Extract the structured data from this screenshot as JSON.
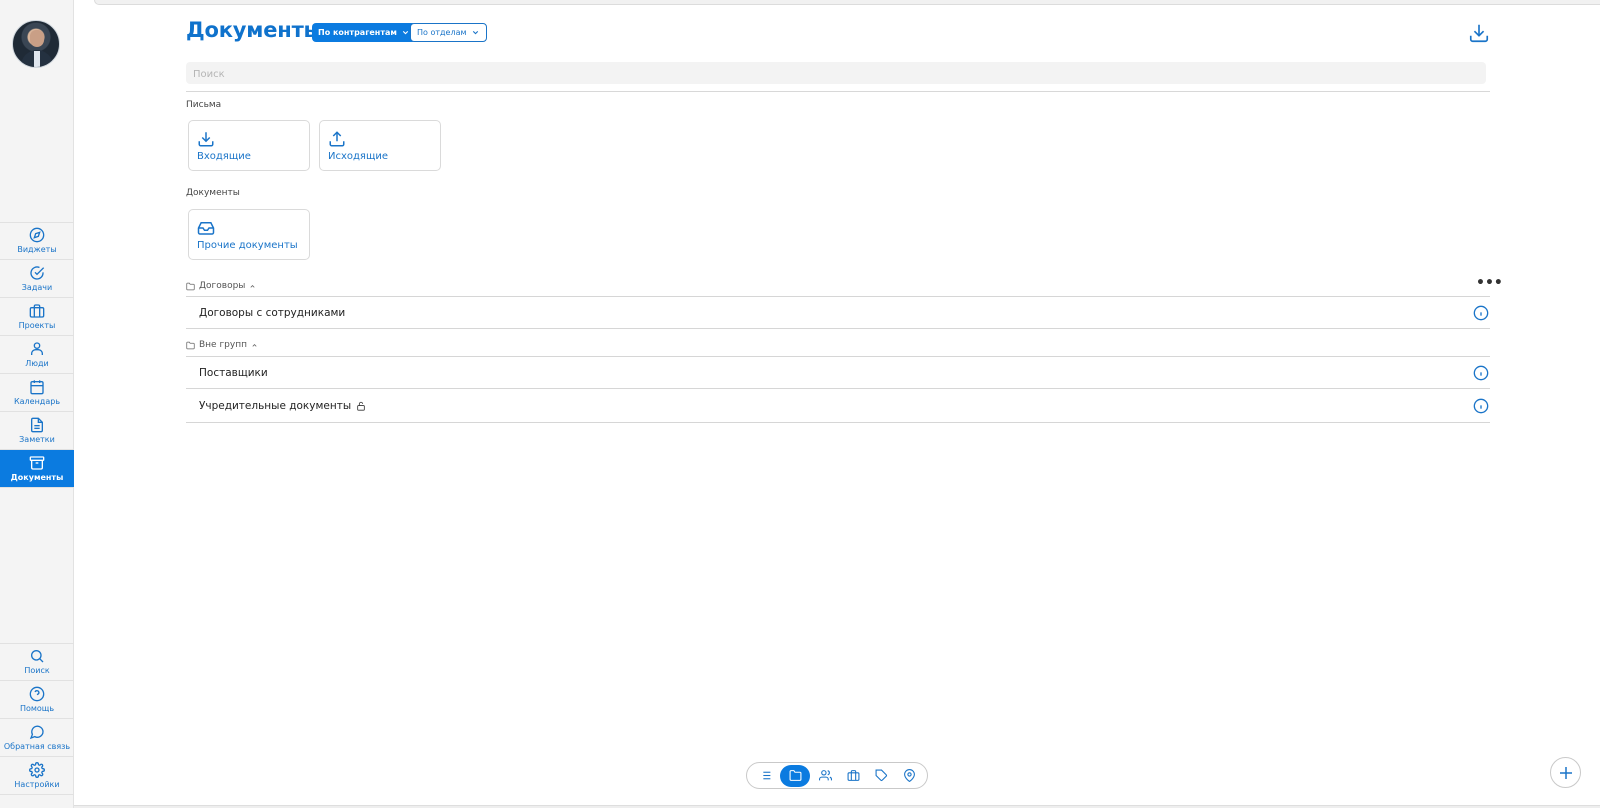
{
  "colors": {
    "accent": "#0b7be0",
    "link": "#1a74c8",
    "sidebar_bg": "#f4f4f4"
  },
  "sidebar": {
    "avatar": "avatar-photo",
    "items": [
      {
        "label": "Виджеты",
        "icon": "compass-icon",
        "active": false
      },
      {
        "label": "Задачи",
        "icon": "check-circle-icon",
        "active": false
      },
      {
        "label": "Проекты",
        "icon": "briefcase-icon",
        "active": false
      },
      {
        "label": "Люди",
        "icon": "user-icon",
        "active": false
      },
      {
        "label": "Календарь",
        "icon": "calendar-icon",
        "active": false
      },
      {
        "label": "Заметки",
        "icon": "note-icon",
        "active": false
      },
      {
        "label": "Документы",
        "icon": "archive-icon",
        "active": true
      }
    ],
    "bottom_items": [
      {
        "label": "Поиск",
        "icon": "search-icon"
      },
      {
        "label": "Помощь",
        "icon": "help-icon"
      },
      {
        "label": "Обратная связь",
        "icon": "chat-icon"
      },
      {
        "label": "Настройки",
        "icon": "gear-icon"
      }
    ]
  },
  "header": {
    "title": "Документы",
    "filter_primary": "По контрагентам",
    "filter_secondary": "По отделам",
    "download_icon": "download-icon"
  },
  "search": {
    "placeholder": "Поиск",
    "value": ""
  },
  "letters": {
    "section_label": "Письма",
    "cards": [
      {
        "label": "Входящие",
        "icon": "download-icon"
      },
      {
        "label": "Исходящие",
        "icon": "upload-icon"
      }
    ]
  },
  "documents": {
    "section_label": "Документы",
    "cards": [
      {
        "label": "Прочие документы",
        "icon": "inbox-icon"
      }
    ]
  },
  "groups": [
    {
      "name": "Договоры",
      "rows": [
        {
          "label": "Договоры с сотрудниками",
          "locked": false
        }
      ]
    },
    {
      "name": "Вне групп",
      "rows": [
        {
          "label": "Поставщики",
          "locked": false
        },
        {
          "label": "Учредительные документы",
          "locked": true
        }
      ]
    }
  ],
  "bottom_toolbar": {
    "items": [
      "list-icon",
      "folder-icon",
      "people-icon",
      "briefcase-icon",
      "tag-icon",
      "location-icon"
    ],
    "active": "folder-icon"
  },
  "fab": "plus-icon"
}
